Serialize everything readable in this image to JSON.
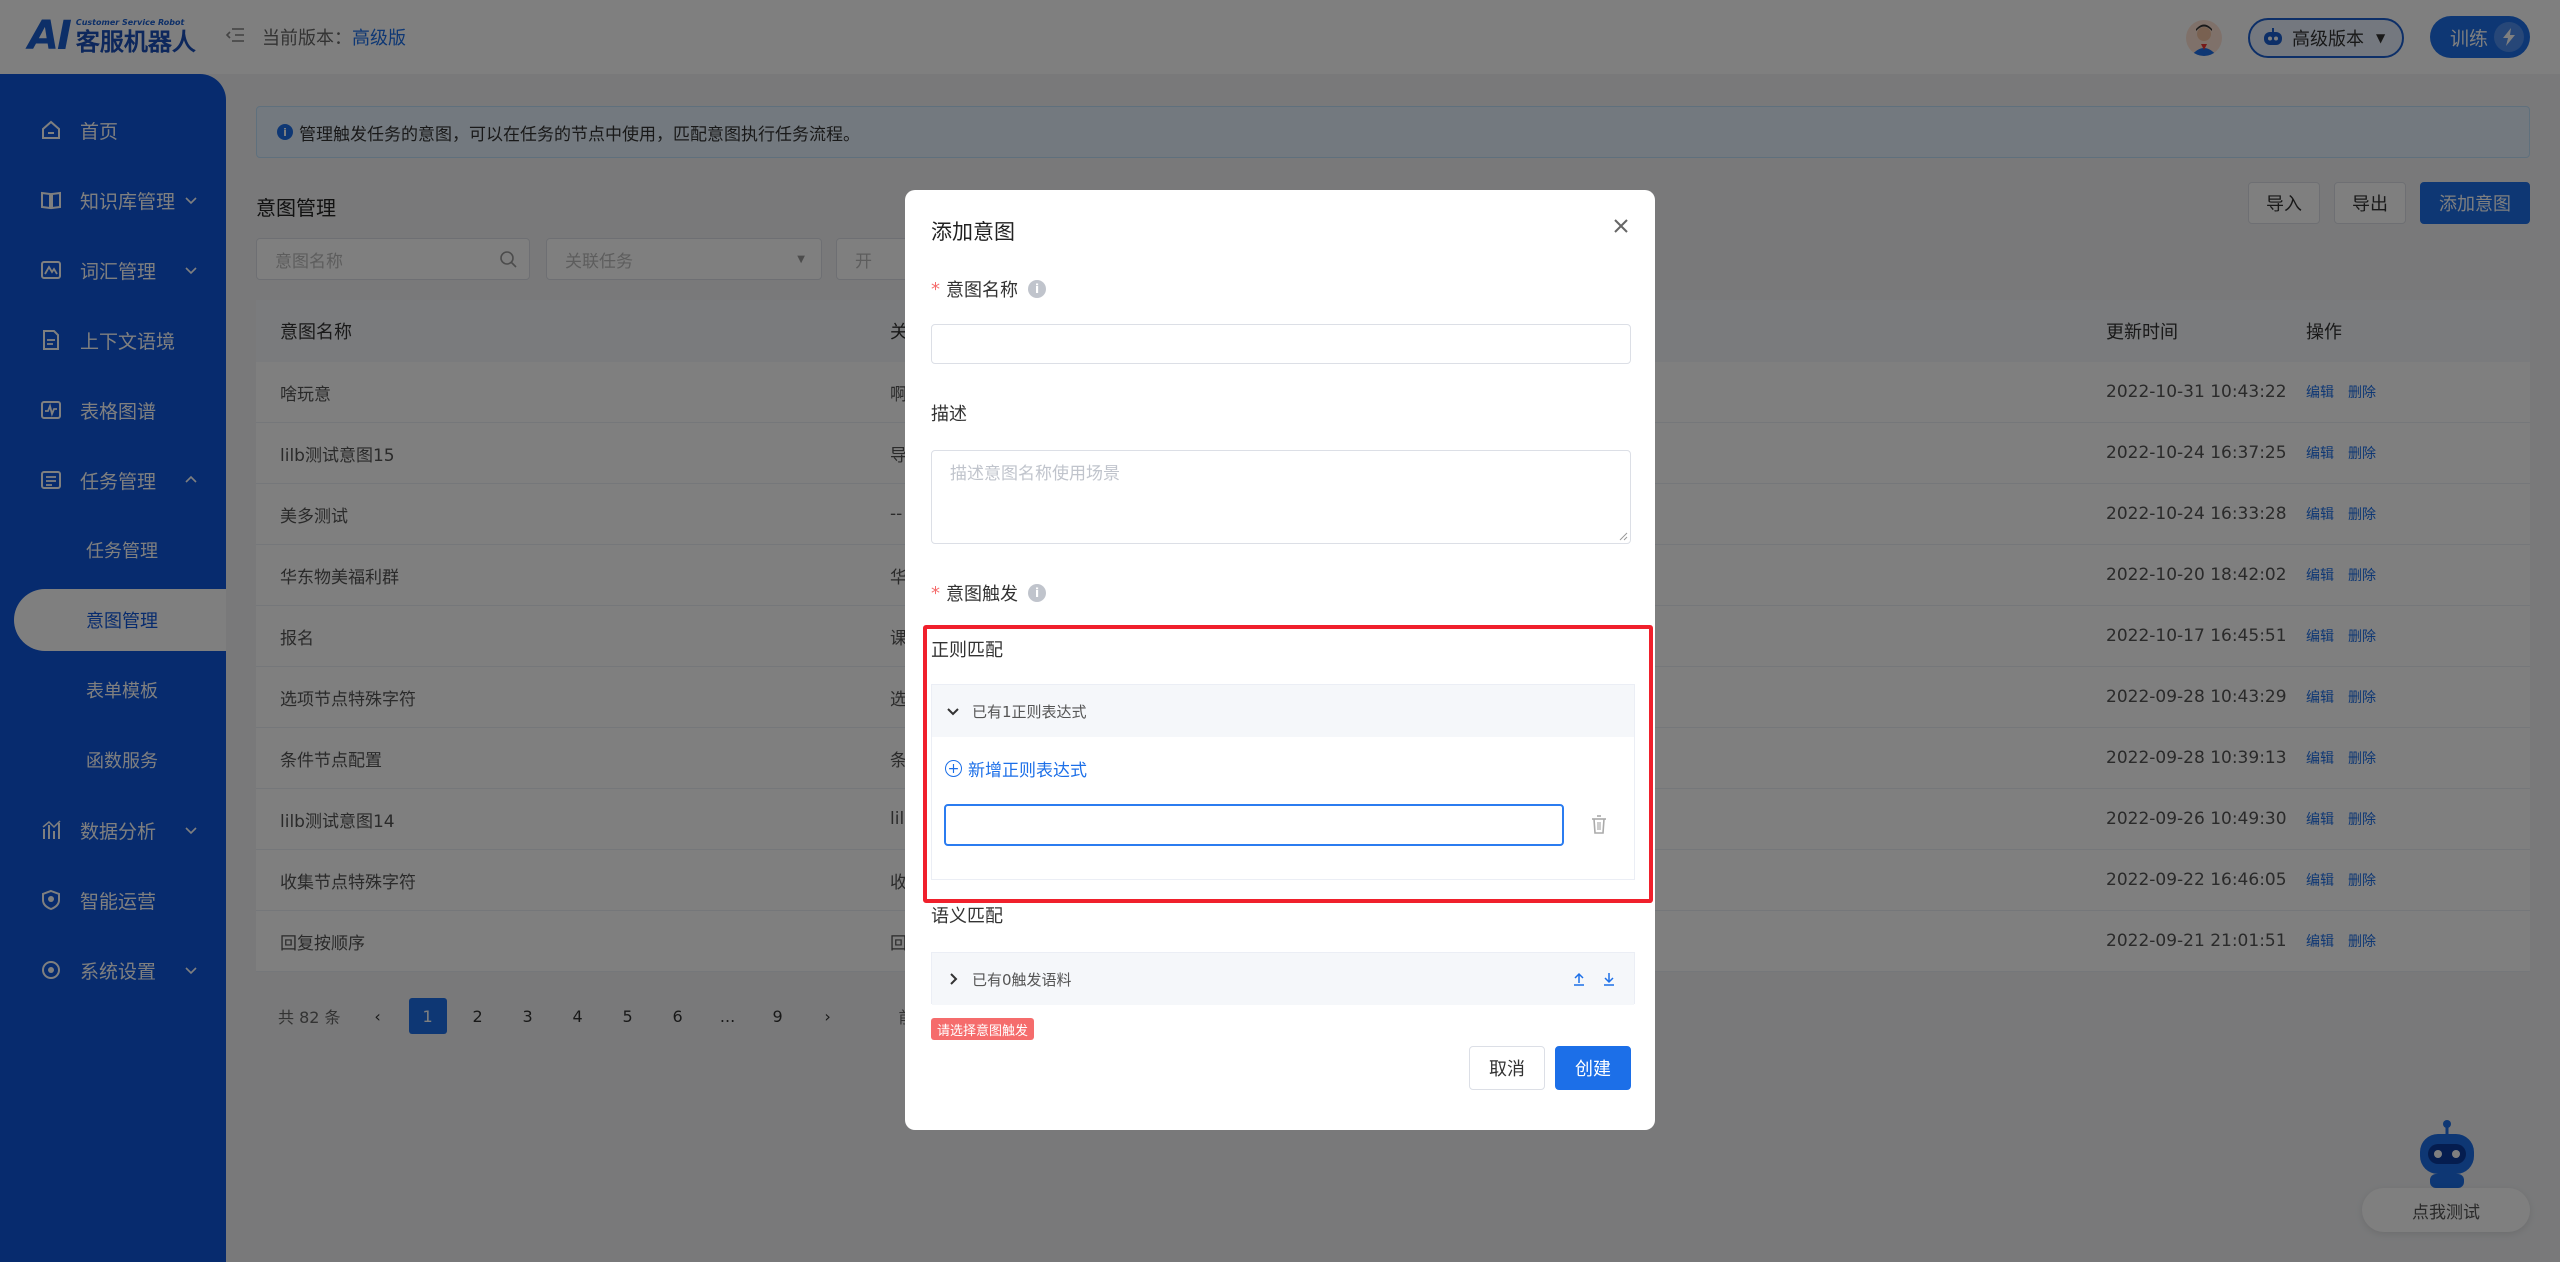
{
  "header": {
    "logo_ai": "AI",
    "logo_en": "Customer Service Robot",
    "logo_cn": "客服机器人",
    "version_prefix": "当前版本：",
    "version_value": "高级版",
    "version_select": "高级版本",
    "train_button": "训练"
  },
  "sidebar": {
    "items": [
      {
        "label": "首页",
        "icon": "home-icon"
      },
      {
        "label": "知识库管理",
        "icon": "book-icon"
      },
      {
        "label": "词汇管理",
        "icon": "vocab-icon"
      },
      {
        "label": "上下文语境",
        "icon": "document-icon"
      },
      {
        "label": "表格图谱",
        "icon": "chart-table-icon"
      },
      {
        "label": "任务管理",
        "icon": "task-icon"
      },
      {
        "label": "数据分析",
        "icon": "analytics-icon"
      },
      {
        "label": "智能运营",
        "icon": "shield-icon"
      },
      {
        "label": "系统设置",
        "icon": "settings-icon"
      }
    ],
    "sub_items": [
      {
        "label": "任务管理"
      },
      {
        "label": "意图管理"
      },
      {
        "label": "表单模板"
      },
      {
        "label": "函数服务"
      }
    ]
  },
  "main": {
    "notice": "管理触发任务的意图，可以在任务的节点中使用，匹配意图执行任务流程。",
    "title": "意图管理",
    "buttons": {
      "import": "导入",
      "export": "导出",
      "add": "添加意图"
    },
    "filters": {
      "name_placeholder": "意图名称",
      "task_placeholder": "关联任务",
      "third_partial": "开"
    },
    "table": {
      "headers": {
        "name": "意图名称",
        "task": "关",
        "updated": "更新时间",
        "ops": "操作"
      },
      "rows": [
        {
          "name": "啥玩意",
          "task": "啊",
          "updated": "2022-10-31 10:43:22"
        },
        {
          "name": "lilb测试意图15",
          "task": "导",
          "updated": "2022-10-24 16:37:25"
        },
        {
          "name": "美多测试",
          "task": "--",
          "updated": "2022-10-24 16:33:28"
        },
        {
          "name": "华东物美福利群",
          "task": "华",
          "updated": "2022-10-20 18:42:02"
        },
        {
          "name": "报名",
          "task": "课",
          "updated": "2022-10-17 16:45:51"
        },
        {
          "name": "选项节点特殊字符",
          "task": "选",
          "updated": "2022-09-28 10:43:29"
        },
        {
          "name": "条件节点配置",
          "task": "条",
          "updated": "2022-09-28 10:39:13"
        },
        {
          "name": "lilb测试意图14",
          "task": "lil",
          "updated": "2022-09-26 10:49:30"
        },
        {
          "name": "收集节点特殊字符",
          "task": "收",
          "updated": "2022-09-22 16:46:05"
        },
        {
          "name": "回复按顺序",
          "task": "回",
          "updated": "2022-09-21 21:01:51"
        }
      ],
      "op_edit": "编辑",
      "op_delete": "删除"
    },
    "pager": {
      "total": "共 82 条",
      "pages": [
        "1",
        "2",
        "3",
        "4",
        "5",
        "6",
        "...",
        "9"
      ],
      "goto_partial": "前"
    }
  },
  "modal": {
    "title": "添加意图",
    "name_label": "意图名称",
    "name_value": "",
    "desc_label": "描述",
    "desc_placeholder": "描述意图名称使用场景",
    "trigger_label": "意图触发",
    "regex_section": "正则匹配",
    "regex_count": "已有1正则表达式",
    "add_regex": "新增正则表达式",
    "regex_value": "",
    "semantic_section": "语义匹配",
    "semantic_count": "已有0触发语料",
    "error_tag": "请选择意图触发",
    "cancel": "取消",
    "create": "创建"
  },
  "robot": {
    "label": "点我测试"
  },
  "colors": {
    "brand": "#1c6fe8",
    "sidebar": "#0e57dc",
    "highlight": "#f0202c",
    "error": "#f56c6c"
  }
}
